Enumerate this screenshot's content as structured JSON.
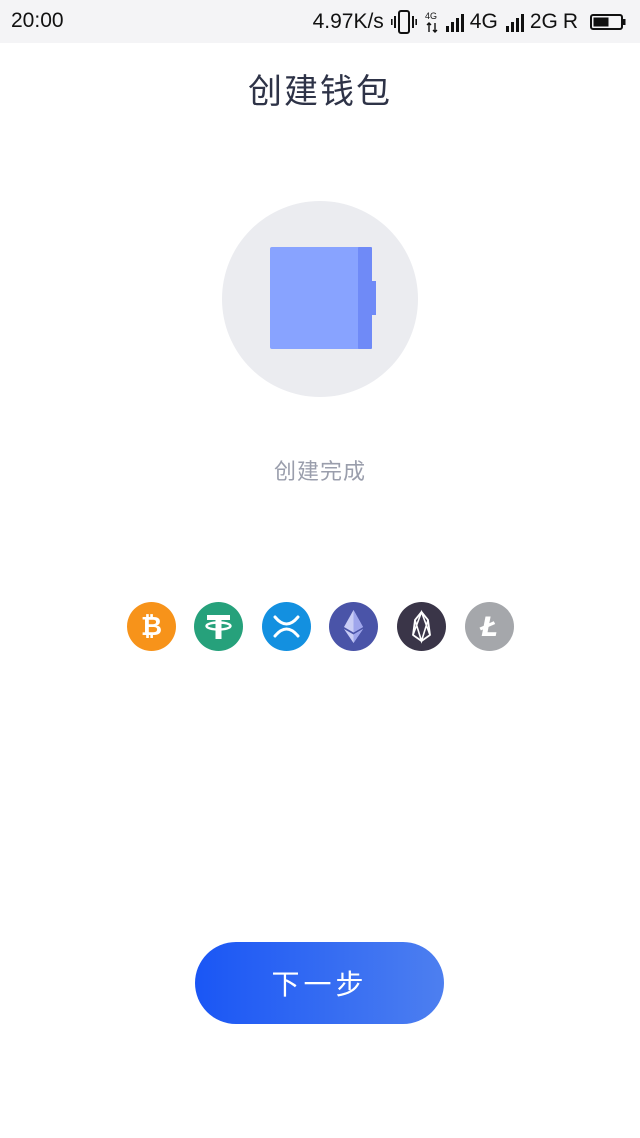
{
  "status_bar": {
    "time": "20:00",
    "speed": "4.97K/s",
    "net_4g_small": "4G",
    "net_4g": "4G",
    "net_2g": "2G",
    "roaming": "R"
  },
  "page": {
    "title": "创建钱包",
    "status_text": "创建完成"
  },
  "coins": [
    {
      "name": "bitcoin",
      "symbol": "₿",
      "color": "#f7931a"
    },
    {
      "name": "tether",
      "symbol": "₮",
      "color": "#26a17b"
    },
    {
      "name": "ripple",
      "symbol": "XRP",
      "color": "#1390e0"
    },
    {
      "name": "ethereum",
      "symbol": "ETH",
      "color": "#4a54a8"
    },
    {
      "name": "eos",
      "symbol": "EOS",
      "color": "#3a3548"
    },
    {
      "name": "litecoin",
      "symbol": "Ł",
      "color": "#a5a7ab"
    }
  ],
  "colors": {
    "accent_start": "#1a56f5",
    "accent_end": "#4d7ff0",
    "wallet_fill": "#88a3ff",
    "wallet_spine": "#6f8af7"
  },
  "actions": {
    "next_label": "下一步"
  }
}
